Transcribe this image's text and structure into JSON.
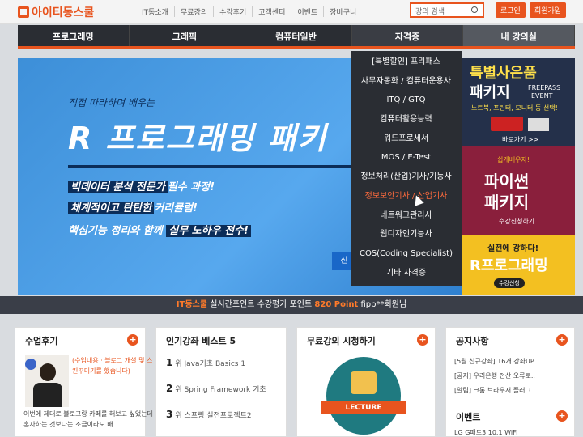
{
  "header": {
    "logo": "아이티동스쿨",
    "nav": [
      "IT동소개",
      "무료강의",
      "수강후기",
      "고객센터",
      "이벤트",
      "장바구니"
    ],
    "search_placeholder": "강의 검색",
    "login": "로그인",
    "signup": "회원가입"
  },
  "mainnav": [
    "프로그래밍",
    "그래픽",
    "컴퓨터일반",
    "자격증",
    "내 강의실"
  ],
  "dropdown": [
    "[특별할인] 프리패스",
    "사무자동화 / 컴퓨터운용사",
    "ITQ / GTQ",
    "컴퓨터활용능력",
    "워드프로세서",
    "MOS / E-Test",
    "정보처리(산업)기사/기능사",
    "정보보안기사 / 산업기사",
    "네트워크관리사",
    "웹디자인기능사",
    "COS(Coding Specialist)",
    "기타 자격증"
  ],
  "banner": {
    "subtitle": "직접 따라하며 배우는",
    "title": "R 프로그래밍 패키",
    "line1_hl": "빅데이터 분석 전문가",
    "line1_rest": "필수 과정!",
    "line2_hl": "체계적이고 탄탄한",
    "line2_rest": "커리큘럼!",
    "line3_pre": "핵심기능 정리와 함께",
    "line3_hl": "실무 노하우 전수!",
    "cta": "신"
  },
  "side": {
    "ad1_title": "특별사은품",
    "ad1_title2": "패키지",
    "ad1_freepass": "FREEPASS",
    "ad1_event": "EVENT",
    "ad1_desc": "노트북, 프린터, 모니터 등 선택!",
    "ad1_link": "바로가기 >>",
    "ad2_small": "쉽게배우자!",
    "ad2_title1": "파이썬",
    "ad2_title2": "패키지",
    "ad2_link": "수강신청하기",
    "ad3_small": "실전에 강하다!",
    "ad3_title": "R프로그래밍",
    "ad3_link": "수강신청"
  },
  "ticker": {
    "brand": "IT동스쿨",
    "text": "실시간포인트 수강평가 포인트",
    "points": "820 Point",
    "user": "fipp**회원님"
  },
  "panels": {
    "review": {
      "title": "수업후기",
      "text1": "(수업내용 · 블로그 개설 및 스킨꾸미기를 했습니다)",
      "text2": "이번에 제대로 블로그랑 카페를 해보고 싶었는데 혼자하는 것보다는 조금이라도 배.."
    },
    "best": {
      "title": "인기강좌 베스트 5",
      "items": [
        "Java기초 Basics 1",
        "Spring Framework 기초",
        "스프링 실전프로젝트2"
      ]
    },
    "free": {
      "title": "무료강의 시청하기",
      "badge": "LECTURE"
    },
    "notice": {
      "title": "공지사항",
      "items": [
        "[5월 신규강좌] 16개 강좌UP..",
        "[공지] 우리은행 전산 오류로..",
        "[알림] 크롬 브라우저 플러그.."
      ],
      "event_title": "이벤트",
      "event_item": "LG G패드3 10.1 WiFi"
    }
  }
}
